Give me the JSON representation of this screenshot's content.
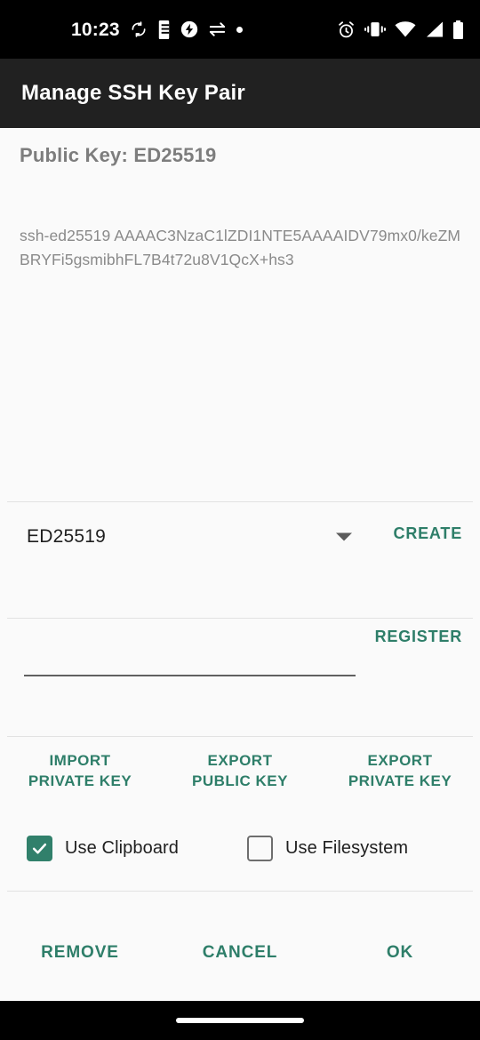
{
  "status_bar": {
    "time": "10:23",
    "left_icons": [
      "sync-disabled-icon",
      "vibrate-phone-icon",
      "flash-charging-icon",
      "data-transfer-icon",
      "dot-indicator-icon"
    ],
    "right_icons": [
      "alarm-clock-icon",
      "vibrate-icon",
      "wifi-icon",
      "cellular-signal-icon",
      "battery-icon"
    ]
  },
  "app_bar": {
    "title": "Manage SSH Key Pair"
  },
  "public_key": {
    "label": "Public Key: ED25519",
    "value": "ssh-ed25519 AAAAC3NzaC1lZDI1NTE5AAAAIDV79mx0/keZMBRYFi5gsmibhFL7B4t72u8V1QcX+hs3"
  },
  "key_type": {
    "selected": "ED25519",
    "create_label": "CREATE"
  },
  "register": {
    "input_value": "",
    "placeholder": "",
    "register_label": "REGISTER"
  },
  "transfer_buttons": [
    {
      "line1": "IMPORT",
      "line2": "PRIVATE KEY"
    },
    {
      "line1": "EXPORT",
      "line2": "PUBLIC KEY"
    },
    {
      "line1": "EXPORT",
      "line2": "PRIVATE KEY"
    }
  ],
  "storage_options": [
    {
      "label": "Use Clipboard",
      "checked": true
    },
    {
      "label": "Use Filesystem",
      "checked": false
    }
  ],
  "actions": [
    {
      "label": "REMOVE"
    },
    {
      "label": "CANCEL"
    },
    {
      "label": "OK"
    }
  ],
  "colors": {
    "accent": "#2e7e69",
    "checkbox_on": "#31806b",
    "app_bar_bg": "#212121",
    "page_bg": "#fafafa",
    "label_gray": "#7d7d7d",
    "key_text_gray": "#8a8a8a",
    "divider": "#e2e2e2"
  }
}
